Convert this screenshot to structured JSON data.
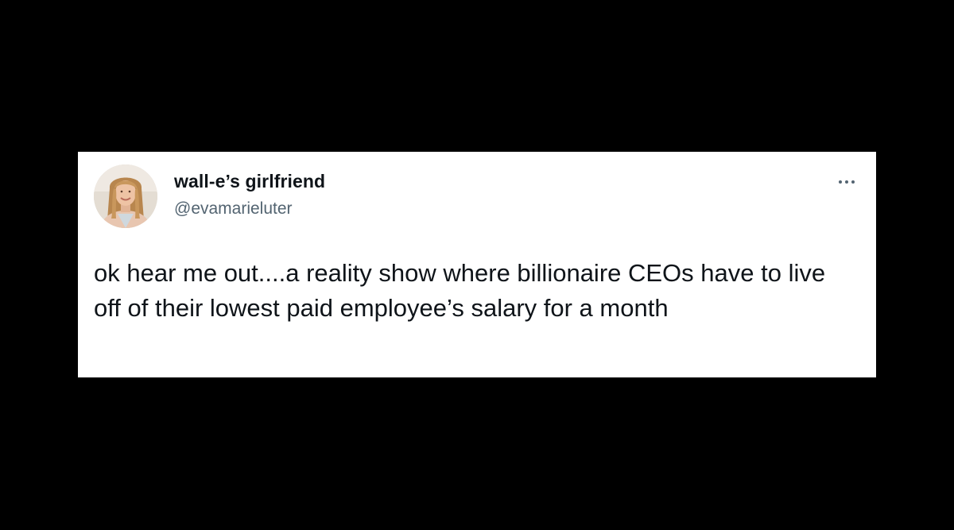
{
  "tweet": {
    "author": {
      "display_name": "wall-e’s girlfriend",
      "handle": "@evamarieluter"
    },
    "menu_icon": "more-horizontal-icon",
    "text": "ok hear me out....a reality show where billionaire CEOs have to live off of their lowest paid employee’s salary for a month"
  },
  "colors": {
    "background": "#000000",
    "card": "#ffffff",
    "text_primary": "#0f1419",
    "text_secondary": "#536471"
  }
}
